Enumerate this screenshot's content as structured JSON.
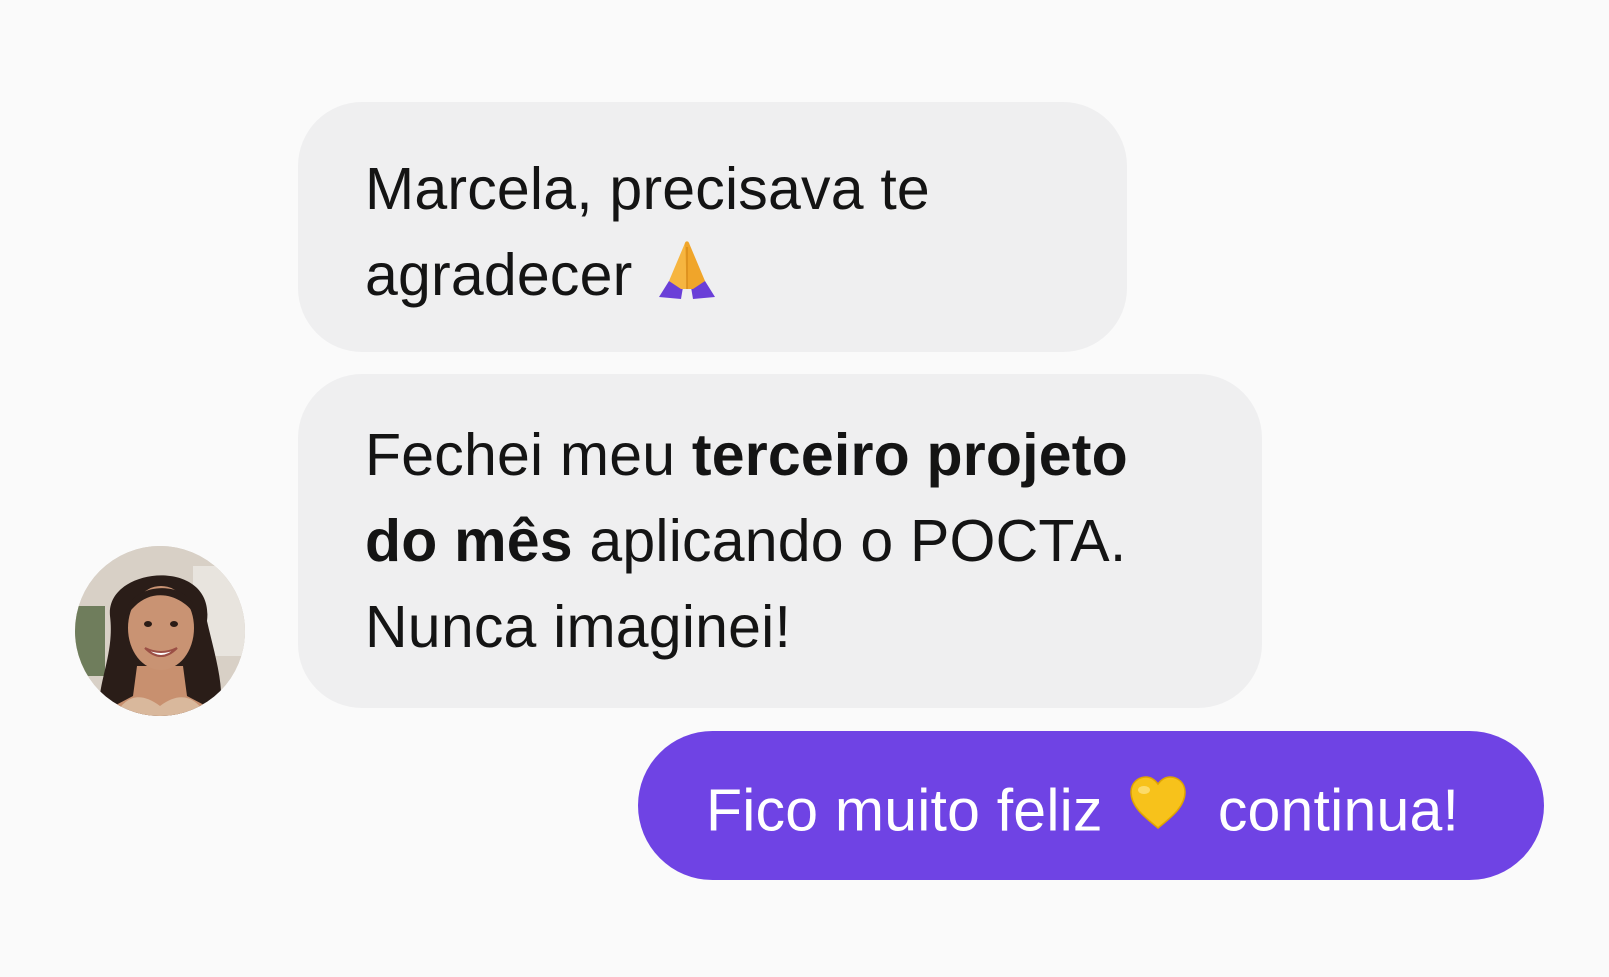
{
  "conversation": {
    "messages": [
      {
        "sender": "contact",
        "line1": "Marcela, precisava te",
        "line2": "agradecer",
        "emoji": "folded-hands-icon"
      },
      {
        "sender": "contact",
        "text_before_bold": "Fechei meu ",
        "bold_line1": "terceiro projeto",
        "bold_line2": "do mês",
        "text_after_bold": " aplicando o POCTA.",
        "line3": "Nunca imaginei!"
      },
      {
        "sender": "me",
        "text_before_emoji": "Fico muito feliz",
        "emoji": "yellow-heart-icon",
        "text_after_emoji": "continua!"
      }
    ]
  },
  "colors": {
    "incoming_bubble": "#efeff0",
    "outgoing_bubble": "#6f43e4",
    "incoming_text": "#141414",
    "outgoing_text": "#ffffff",
    "background": "#fafafa"
  }
}
